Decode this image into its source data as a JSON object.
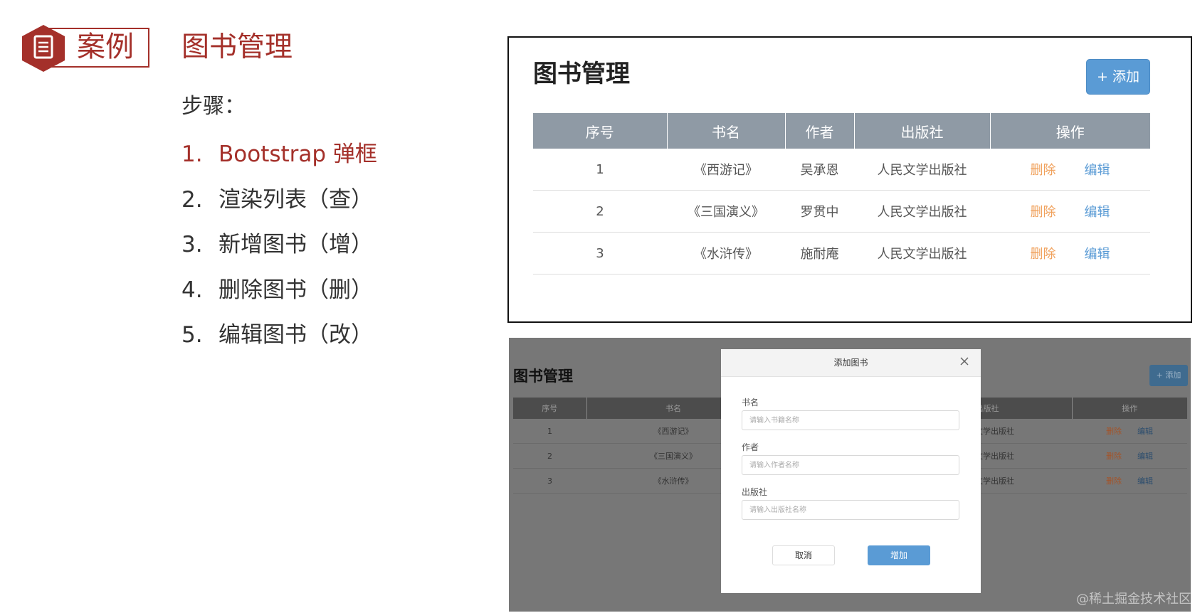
{
  "slide": {
    "badge_text": "案例",
    "title": "图书管理",
    "steps_label": "步骤：",
    "steps": [
      {
        "num": "1.",
        "text": "Bootstrap 弹框"
      },
      {
        "num": "2.",
        "text": "渲染列表（查）"
      },
      {
        "num": "3.",
        "text": "新增图书（增）"
      },
      {
        "num": "4.",
        "text": "删除图书（删）"
      },
      {
        "num": "5.",
        "text": "编辑图书（改）"
      }
    ],
    "accent_color": "#a4302a"
  },
  "book_page": {
    "title": "图书管理",
    "add_button": "+ 添加",
    "columns": [
      "序号",
      "书名",
      "作者",
      "出版社",
      "操作"
    ],
    "rows": [
      {
        "id": "1",
        "name": "《西游记》",
        "author": "吴承恩",
        "publisher": "人民文学出版社",
        "delete": "删除",
        "edit": "编辑"
      },
      {
        "id": "2",
        "name": "《三国演义》",
        "author": "罗贯中",
        "publisher": "人民文学出版社",
        "delete": "删除",
        "edit": "编辑"
      },
      {
        "id": "3",
        "name": "《水浒传》",
        "author": "施耐庵",
        "publisher": "人民文学出版社",
        "delete": "删除",
        "edit": "编辑"
      }
    ]
  },
  "modal_page": {
    "bg_title": "图书管理",
    "bg_add_button": "+ 添加",
    "bg_columns": [
      "序号",
      "书名",
      "出版社",
      "操作"
    ],
    "bg_rows": [
      {
        "id": "1",
        "name": "《西游记》",
        "publisher": "文学出版社",
        "delete": "删除",
        "edit": "编辑"
      },
      {
        "id": "2",
        "name": "《三国演义》",
        "publisher": "文学出版社",
        "delete": "删除",
        "edit": "编辑"
      },
      {
        "id": "3",
        "name": "《水浒传》",
        "publisher": "文学出版社",
        "delete": "删除",
        "edit": "编辑"
      }
    ],
    "modal": {
      "title": "添加图书",
      "fields": [
        {
          "label": "书名",
          "placeholder": "请输入书籍名称"
        },
        {
          "label": "作者",
          "placeholder": "请输入作者名称"
        },
        {
          "label": "出版社",
          "placeholder": "请输入出版社名称"
        }
      ],
      "cancel": "取消",
      "confirm": "增加"
    }
  },
  "watermark": "@稀土掘金技术社区"
}
